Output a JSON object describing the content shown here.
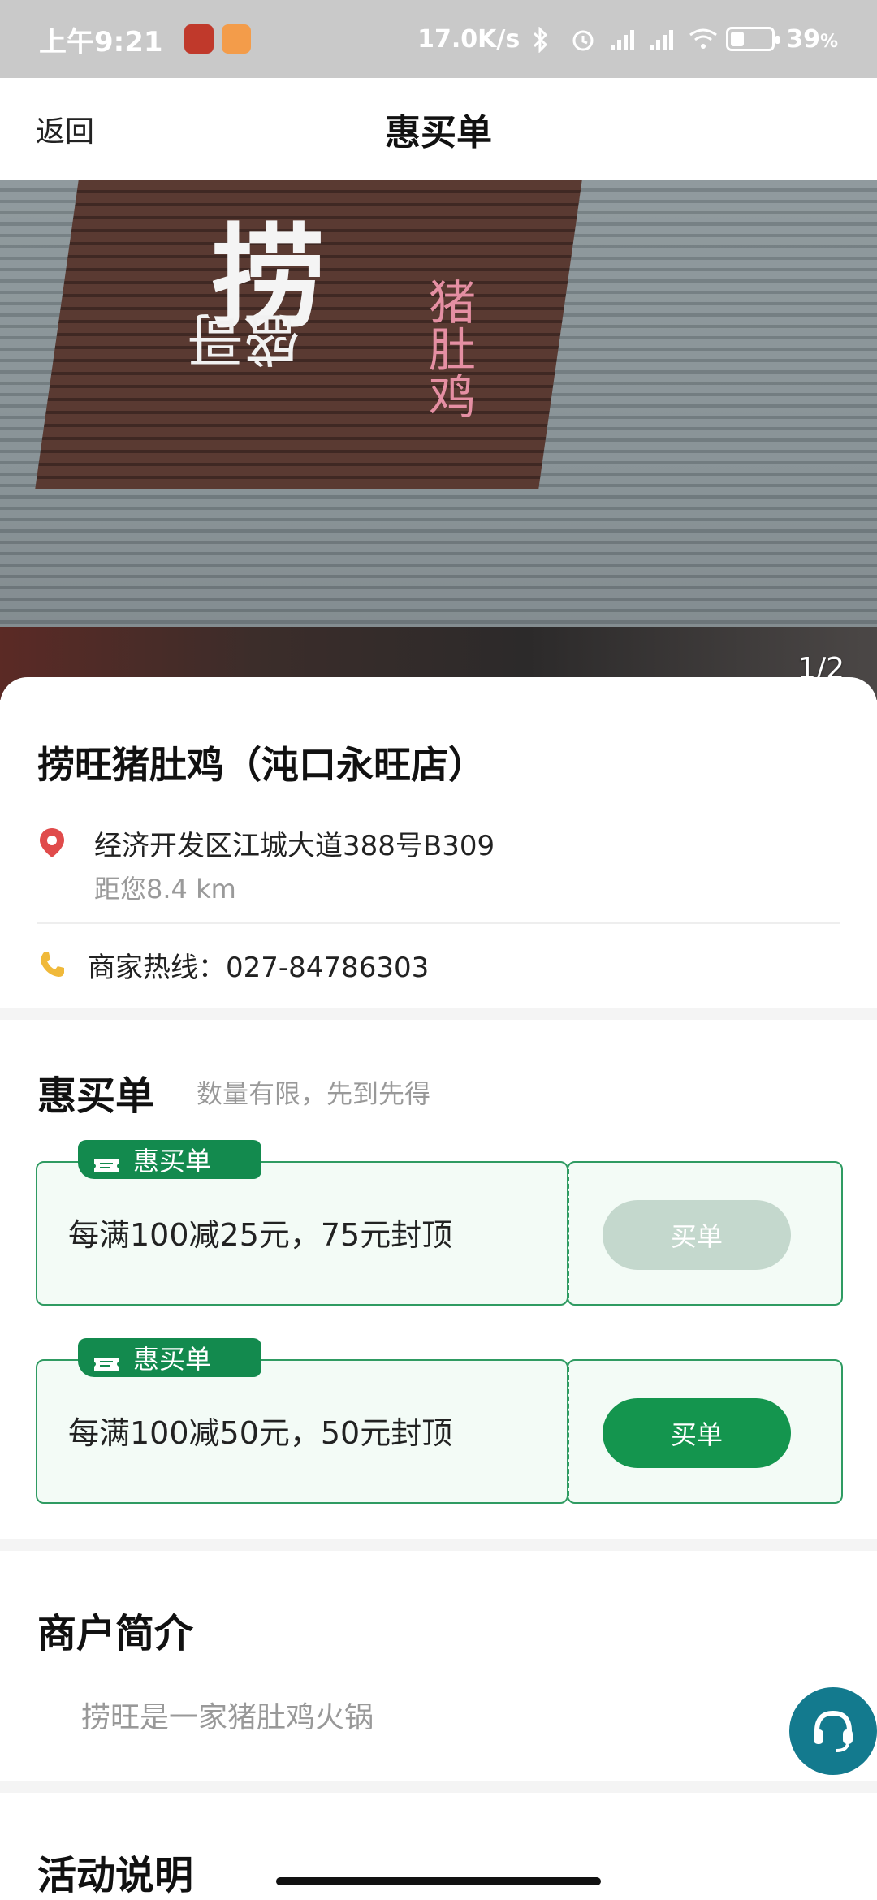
{
  "status_bar": {
    "time": "上午9:21",
    "network_speed": "17.0K/s",
    "battery_percent": "39",
    "battery_symbol": "%"
  },
  "nav": {
    "back_label": "返回",
    "title": "惠买单"
  },
  "hero": {
    "sign_main": "捞",
    "sign_sub": "猪肚鸡",
    "sign_side": "盛哥",
    "image_counter": "1/2"
  },
  "store": {
    "name": "捞旺猪肚鸡（沌口永旺店）",
    "address": "经济开发区江城大道388号B309",
    "distance": "距您8.4 km",
    "phone": "商家热线：027-84786303"
  },
  "deals": {
    "title": "惠买单",
    "subtitle": "数量有限，先到先得",
    "items": [
      {
        "tag": "惠买单",
        "description": "每满100减25元，75元封顶",
        "button": "买单",
        "enabled": false
      },
      {
        "tag": "惠买单",
        "description": "每满100减50元，50元封顶",
        "button": "买单",
        "enabled": true
      }
    ]
  },
  "merchant_intro": {
    "title": "商户简介",
    "text": "捞旺是一家猪肚鸡火锅"
  },
  "activity": {
    "title": "活动说明"
  },
  "colors": {
    "primary_green": "#14954e",
    "disabled_green": "#c4d8cd",
    "tag_green": "#138a4e",
    "pin_red": "#e04b4b",
    "phone_yellow": "#f0b93a",
    "fab_teal": "#137a8e"
  },
  "icons": {
    "location": "location-pin-icon",
    "phone": "phone-icon",
    "ticket": "ticket-icon",
    "customer_service": "headset-icon"
  }
}
